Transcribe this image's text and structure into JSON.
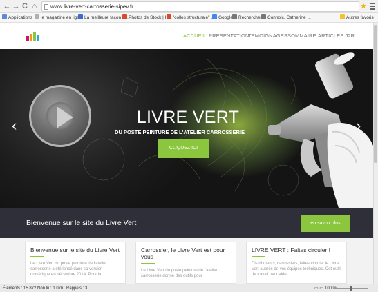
{
  "browser": {
    "url": "www.livre-vert-carrosserie-sipev.fr",
    "bookmarks": [
      {
        "label": "Applications",
        "color": "#5b8bd8"
      },
      {
        "label": "le magazine en lign...",
        "color": "#b0b0b0"
      },
      {
        "label": "La meilleure façon d...",
        "color": "#3a6bd3"
      },
      {
        "label": "Photos de Stock | Ill...",
        "color": "#d94a2b"
      },
      {
        "label": "\"colles structurale\" ...",
        "color": "#d94a2b"
      },
      {
        "label": "Google",
        "color": "#4285f4"
      },
      {
        "label": "Rechercher",
        "color": "#777777"
      },
      {
        "label": "Connolc, Catherine ...",
        "color": "#777777"
      },
      {
        "label": "Autres favoris",
        "color": "#f1c232"
      }
    ]
  },
  "site": {
    "nav": [
      "ACCUEIL",
      "PRESENTATION",
      "TEMOIGNAGES",
      "SOMMAIRE",
      "ARTICLES J2R"
    ],
    "active_nav": "ACCUEIL",
    "accent_color": "#8cc63f",
    "hero": {
      "title": "LIVRE VERT",
      "subtitle": "DU POSTE PEINTURE DE L'ATELIER CARROSSERIE",
      "button": "CLIQUEZ ICI",
      "prev_icon": "chevron-left-icon",
      "next_icon": "chevron-right-icon"
    },
    "band": {
      "text": "Bienvenue sur le site du Livre Vert",
      "button": "en savoir plus"
    },
    "cards": [
      {
        "title": "Bienvenue sur le site du Livre Vert",
        "text": "Le Livre Vert du poste peinture de l'atelier carrosserie a été lancé dans sa version numérique en décembre 2014. Pour la"
      },
      {
        "title": "Carrossier, le Livre Vert est pour vous",
        "text": "Le Livre Vert du poste peinture de l'atelier carrosserie donne des outils pour"
      },
      {
        "title": "LIVRE VERT : Faites circuler !",
        "text": "Distributeurs, carrossiers, faites circuler le Livre Vert auprès de vos équipes techniques. Cet outil de travail peut aider"
      }
    ]
  },
  "statusbar": {
    "elements": "Éléments : 15 872",
    "nonlus": "Non lu : 1 076",
    "rappels": "Rappels : 3",
    "zoom": "100 %"
  }
}
